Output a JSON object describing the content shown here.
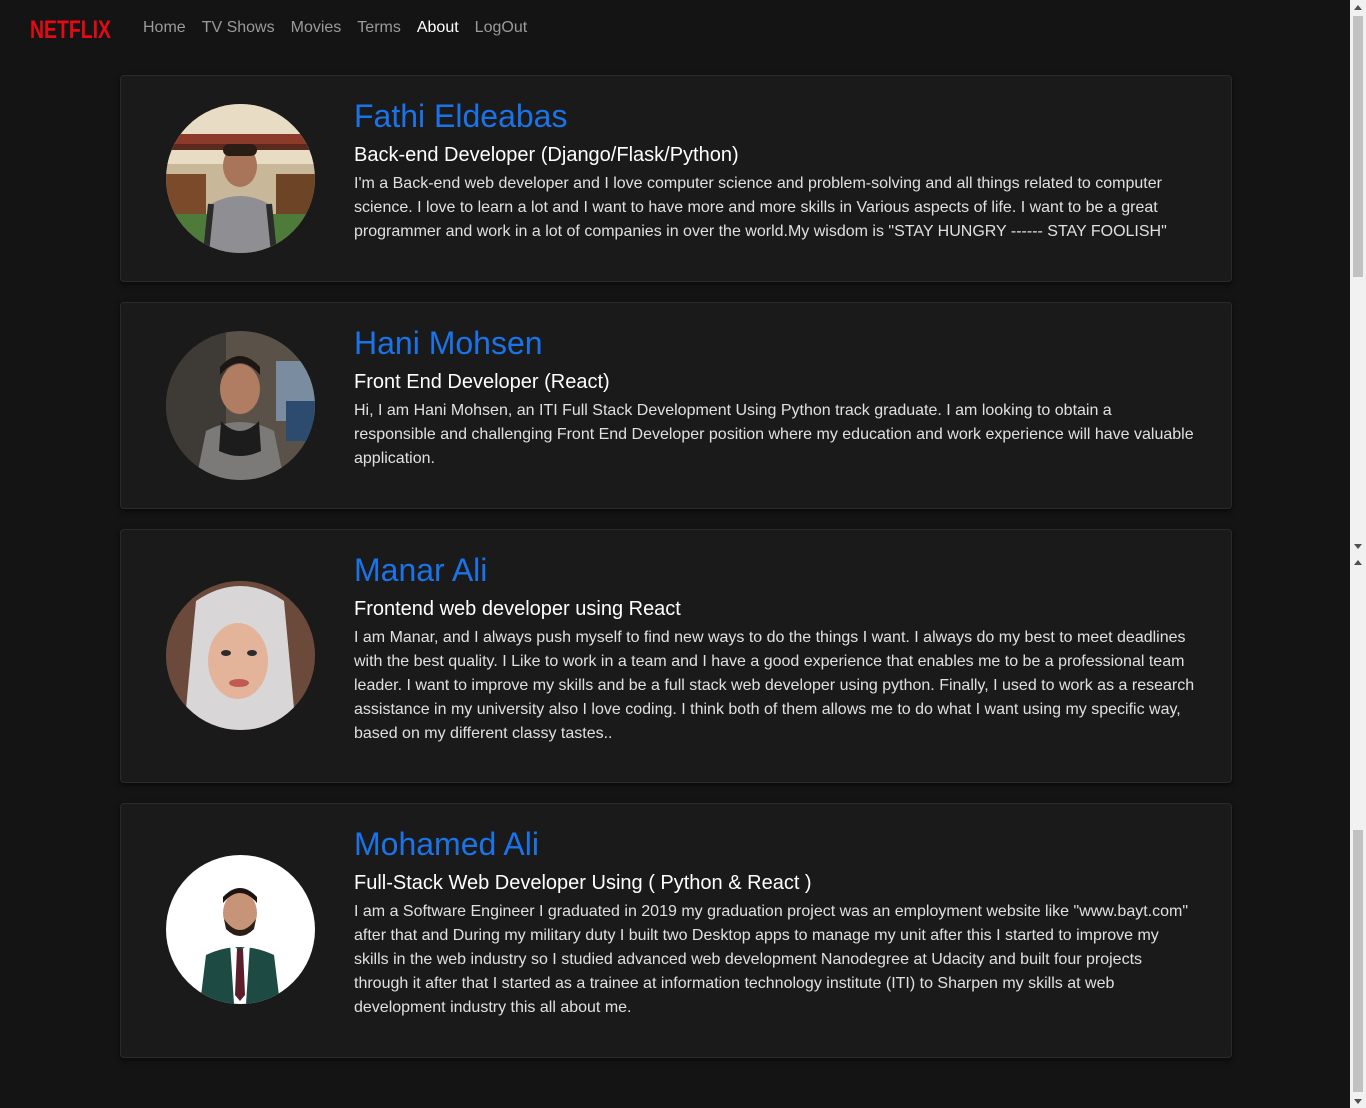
{
  "brand": {
    "name": "NETFLIX",
    "color": "#e50914"
  },
  "nav": {
    "items": [
      {
        "label": "Home",
        "active": false
      },
      {
        "label": "TV Shows",
        "active": false
      },
      {
        "label": "Movies",
        "active": false
      },
      {
        "label": "Terms",
        "active": false
      },
      {
        "label": "About",
        "active": true
      },
      {
        "label": "LogOut",
        "active": false
      }
    ]
  },
  "team": [
    {
      "name": "Fathi Eldeabas",
      "role": "Back-end Developer (Django/Flask/Python)",
      "bio": "I'm a Back-end web developer and I love computer science and problem-solving and all things related to computer science. I love to learn a lot and I want to have more and more skills in Various aspects of life. I want to be a great programmer and work in a lot of companies in over the world.My wisdom is \"STAY HUNGRY ------ STAY FOOLISH\""
    },
    {
      "name": "Hani Mohsen",
      "role": "Front End Developer (React)",
      "bio": "Hi, I am Hani Mohsen, an ITI Full Stack Development Using Python track graduate. I am looking to obtain a responsible and challenging Front End Developer position where my education and work experience will have valuable application."
    },
    {
      "name": "Manar Ali",
      "role": "Frontend web developer using React",
      "bio": "I am Manar, and I always push myself to find new ways to do the things I want. I always do my best to meet deadlines with the best quality. I Like to work in a team and I have a good experience that enables me to be a professional team leader. I want to improve my skills and be a full stack web developer using python. Finally, I used to work as a research assistance in my university also I love coding. I think both of them allows me to do what I want using my specific way, based on my different classy tastes.."
    },
    {
      "name": "Mohamed Ali",
      "role": "Full-Stack Web Developer Using ( Python & React )",
      "bio": "I am a Software Engineer I graduated in 2019 my graduation project was an employment website like \"www.bayt.com\" after that and During my military duty I built two Desktop apps to manage my unit after this I started to improve my skills in the web industry so I studied advanced web development Nanodegree at Udacity and built four projects through it after that I started as a trainee at information technology institute (ITI) to Sharpen my skills at web development industry this all about me."
    }
  ],
  "colors": {
    "background": "#141414",
    "card": "#1a1a1a",
    "name": "#1a73e8",
    "nav_inactive": "#9a9a9a",
    "nav_active": "#ffffff"
  }
}
